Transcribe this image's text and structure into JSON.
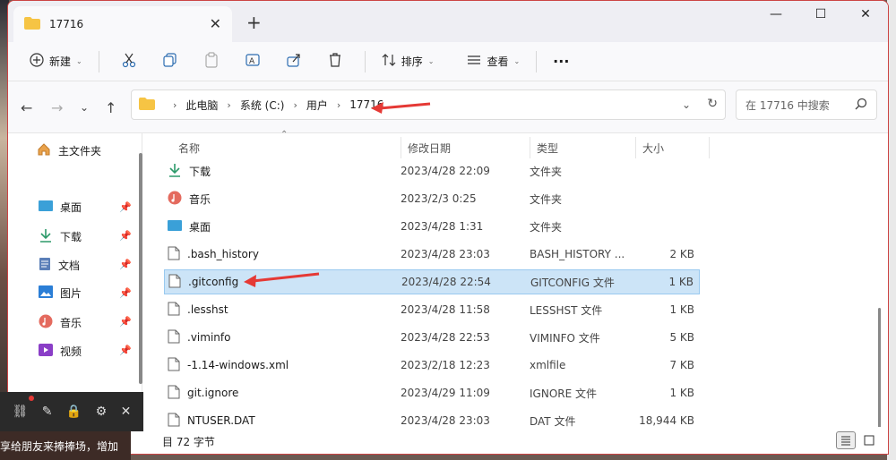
{
  "tab": {
    "title": "17716"
  },
  "window_controls": {
    "minimize": "—",
    "maximize": "☐",
    "close": "✕"
  },
  "toolbar": {
    "new_label": "新建",
    "sort_label": "排序",
    "view_label": "查看",
    "more_label": "···"
  },
  "breadcrumb": [
    "此电脑",
    "系统 (C:)",
    "用户",
    "17716"
  ],
  "search": {
    "placeholder": "在 17716 中搜索"
  },
  "sidebar": {
    "home": "主文件夹",
    "items": [
      {
        "label": "桌面",
        "icon": "desktop-icon"
      },
      {
        "label": "下载",
        "icon": "download-icon"
      },
      {
        "label": "文档",
        "icon": "document-icon"
      },
      {
        "label": "图片",
        "icon": "picture-icon"
      },
      {
        "label": "音乐",
        "icon": "music-icon"
      },
      {
        "label": "视频",
        "icon": "video-icon"
      }
    ]
  },
  "columns": {
    "name": "名称",
    "date": "修改日期",
    "type": "类型",
    "size": "大小"
  },
  "files": [
    {
      "name": "下载",
      "date": "2023/4/28 22:09",
      "type": "文件夹",
      "size": "",
      "icon": "download-folder-icon"
    },
    {
      "name": "音乐",
      "date": "2023/2/3 0:25",
      "type": "文件夹",
      "size": "",
      "icon": "music-folder-icon"
    },
    {
      "name": "桌面",
      "date": "2023/4/28 1:31",
      "type": "文件夹",
      "size": "",
      "icon": "desktop-folder-icon"
    },
    {
      "name": ".bash_history",
      "date": "2023/4/28 23:03",
      "type": "BASH_HISTORY ...",
      "size": "2 KB",
      "icon": "file-icon"
    },
    {
      "name": ".gitconfig",
      "date": "2023/4/28 22:54",
      "type": "GITCONFIG 文件",
      "size": "1 KB",
      "icon": "file-icon",
      "selected": true
    },
    {
      "name": ".lesshst",
      "date": "2023/4/28 11:58",
      "type": "LESSHST 文件",
      "size": "1 KB",
      "icon": "file-icon"
    },
    {
      "name": ".viminfo",
      "date": "2023/4/28 22:53",
      "type": "VIMINFO 文件",
      "size": "5 KB",
      "icon": "file-icon"
    },
    {
      "name": "-1.14-windows.xml",
      "date": "2023/2/18 12:23",
      "type": "xmlfile",
      "size": "7 KB",
      "icon": "file-icon"
    },
    {
      "name": "git.ignore",
      "date": "2023/4/29 11:09",
      "type": "IGNORE 文件",
      "size": "1 KB",
      "icon": "file-icon"
    },
    {
      "name": "NTUSER.DAT",
      "date": "2023/4/28 23:03",
      "type": "DAT 文件",
      "size": "18,944 KB",
      "icon": "file-icon"
    }
  ],
  "status": {
    "text": "目 72 字节"
  },
  "overlay_banner": "享给朋友来捧捧场，增加",
  "colors": {
    "accent": "#0067c0",
    "selected_bg": "#cce4f7",
    "arrow_red": "#e53935"
  }
}
